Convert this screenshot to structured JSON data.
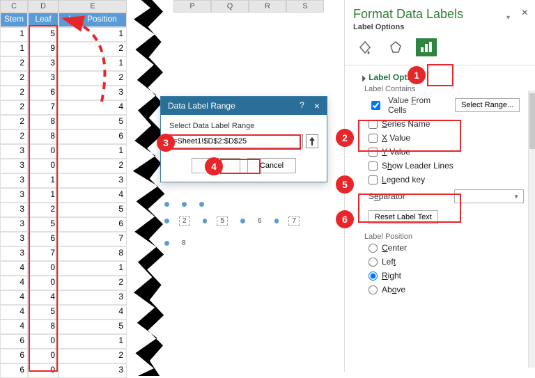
{
  "columns": {
    "C": "C",
    "D": "D",
    "E": "E"
  },
  "headers": {
    "stem": "Stem",
    "leaf": "Leaf",
    "pos": "Leaf Position"
  },
  "grid": [
    {
      "stem": 1,
      "leaf": 5,
      "pos": 1
    },
    {
      "stem": 1,
      "leaf": 9,
      "pos": 2
    },
    {
      "stem": 2,
      "leaf": 3,
      "pos": 1
    },
    {
      "stem": 2,
      "leaf": 3,
      "pos": 2
    },
    {
      "stem": 2,
      "leaf": 6,
      "pos": 3
    },
    {
      "stem": 2,
      "leaf": 7,
      "pos": 4
    },
    {
      "stem": 2,
      "leaf": 8,
      "pos": 5
    },
    {
      "stem": 2,
      "leaf": 8,
      "pos": 6
    },
    {
      "stem": 3,
      "leaf": 0,
      "pos": 1
    },
    {
      "stem": 3,
      "leaf": 0,
      "pos": 2
    },
    {
      "stem": 3,
      "leaf": 1,
      "pos": 3
    },
    {
      "stem": 3,
      "leaf": 1,
      "pos": 4
    },
    {
      "stem": 3,
      "leaf": 2,
      "pos": 5
    },
    {
      "stem": 3,
      "leaf": 5,
      "pos": 6
    },
    {
      "stem": 3,
      "leaf": 6,
      "pos": 7
    },
    {
      "stem": 3,
      "leaf": 7,
      "pos": 8
    },
    {
      "stem": 4,
      "leaf": 0,
      "pos": 1
    },
    {
      "stem": 4,
      "leaf": 0,
      "pos": 2
    },
    {
      "stem": 4,
      "leaf": 4,
      "pos": 3
    },
    {
      "stem": 4,
      "leaf": 5,
      "pos": 4
    },
    {
      "stem": 4,
      "leaf": 8,
      "pos": 5
    },
    {
      "stem": 6,
      "leaf": 0,
      "pos": 1
    },
    {
      "stem": 6,
      "leaf": 0,
      "pos": 2
    },
    {
      "stem": 6,
      "leaf": 0,
      "pos": 3
    }
  ],
  "upper_cols": {
    "P": "P",
    "Q": "Q",
    "R": "R",
    "S": "S"
  },
  "upper_first": "1",
  "dialog": {
    "title": "Data Label Range",
    "help": "?",
    "label": "Select Data Label Range",
    "value": "=Sheet1!$D$2:$D$25",
    "ok": "OK",
    "cancel": "Cancel"
  },
  "pane": {
    "title": "Format Data Labels",
    "subtitle": "Label Options",
    "section": "Label Options",
    "label_contains": "Label Contains",
    "value_from_cells": "Value From Cells",
    "select_range": "Select Range...",
    "series_name": "Series Name",
    "x_value": "X Value",
    "y_value": "Y Value",
    "leader_lines": "Show Leader Lines",
    "legend_key": "Legend key",
    "separator": "Separator",
    "sep_value": ",",
    "reset": "Reset Label Text",
    "label_position": "Label Position",
    "pos_center": "Center",
    "pos_left": "Left",
    "pos_right": "Right",
    "pos_above": "Above"
  },
  "chart_labels": {
    "a": "2",
    "b": "5",
    "c": "6",
    "d": "7",
    "e": "8"
  },
  "circles": {
    "c1": "1",
    "c2": "2",
    "c3": "3",
    "c4": "4",
    "c5": "5",
    "c6": "6"
  }
}
